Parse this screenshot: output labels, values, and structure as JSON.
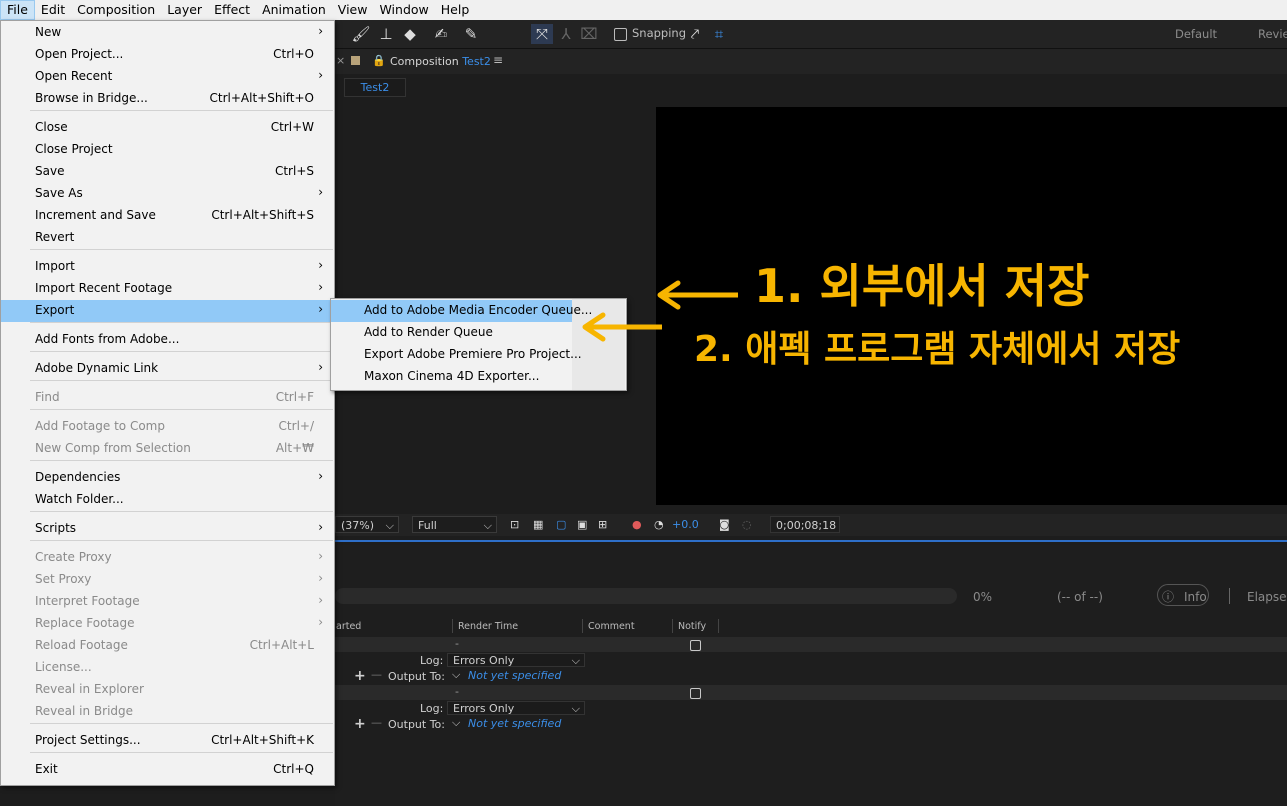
{
  "menubar": [
    "File",
    "Edit",
    "Composition",
    "Layer",
    "Effect",
    "Animation",
    "View",
    "Window",
    "Help"
  ],
  "toolbar": {
    "snapping": "Snapping",
    "workspaces": [
      "Default",
      "Review"
    ]
  },
  "composition": {
    "tab_prefix": "Composition",
    "tab_name": "Test2",
    "subtab": "Test2"
  },
  "viewer_bar": {
    "zoom": "(37%)",
    "resolution": "Full",
    "exposure": "+0.0",
    "timecode": "0;00;08;18"
  },
  "render_queue": {
    "progress": "0%",
    "count": "(-- of --)",
    "info": "Info",
    "elapsed": "Elapse",
    "headers": {
      "started": "arted",
      "render_time": "Render Time",
      "comment": "Comment",
      "notify": "Notify"
    },
    "items": [
      {
        "dash": "-",
        "log_label": "Log:",
        "log": "Errors Only",
        "output_label": "Output To:",
        "output": "Not yet specified"
      },
      {
        "dash": "-",
        "log_label": "Log:",
        "log": "Errors Only",
        "output_label": "Output To:",
        "output": "Not yet specified"
      }
    ]
  },
  "file_menu": [
    {
      "label": "New",
      "shortcut": "",
      "arrow": true,
      "disabled": false
    },
    {
      "label": "Open Project...",
      "shortcut": "Ctrl+O",
      "arrow": false,
      "disabled": false
    },
    {
      "label": "Open Recent",
      "shortcut": "",
      "arrow": true,
      "disabled": false
    },
    {
      "label": "Browse in Bridge...",
      "shortcut": "Ctrl+Alt+Shift+O",
      "arrow": false,
      "disabled": false
    },
    {
      "label": "Close",
      "shortcut": "Ctrl+W",
      "arrow": false,
      "disabled": false
    },
    {
      "label": "Close Project",
      "shortcut": "",
      "arrow": false,
      "disabled": false
    },
    {
      "label": "Save",
      "shortcut": "Ctrl+S",
      "arrow": false,
      "disabled": false
    },
    {
      "label": "Save As",
      "shortcut": "",
      "arrow": true,
      "disabled": false
    },
    {
      "label": "Increment and Save",
      "shortcut": "Ctrl+Alt+Shift+S",
      "arrow": false,
      "disabled": false
    },
    {
      "label": "Revert",
      "shortcut": "",
      "arrow": false,
      "disabled": false
    },
    {
      "label": "Import",
      "shortcut": "",
      "arrow": true,
      "disabled": false
    },
    {
      "label": "Import Recent Footage",
      "shortcut": "",
      "arrow": true,
      "disabled": false
    },
    {
      "label": "Export",
      "shortcut": "",
      "arrow": true,
      "disabled": false,
      "highlighted": true
    },
    {
      "label": "Add Fonts from Adobe...",
      "shortcut": "",
      "arrow": false,
      "disabled": false
    },
    {
      "label": "Adobe Dynamic Link",
      "shortcut": "",
      "arrow": true,
      "disabled": false
    },
    {
      "label": "Find",
      "shortcut": "Ctrl+F",
      "arrow": false,
      "disabled": true
    },
    {
      "label": "Add Footage to Comp",
      "shortcut": "Ctrl+/",
      "arrow": false,
      "disabled": true
    },
    {
      "label": "New Comp from Selection",
      "shortcut": "Alt+₩",
      "arrow": false,
      "disabled": true
    },
    {
      "label": "Dependencies",
      "shortcut": "",
      "arrow": true,
      "disabled": false
    },
    {
      "label": "Watch Folder...",
      "shortcut": "",
      "arrow": false,
      "disabled": false
    },
    {
      "label": "Scripts",
      "shortcut": "",
      "arrow": true,
      "disabled": false
    },
    {
      "label": "Create Proxy",
      "shortcut": "",
      "arrow": true,
      "disabled": true
    },
    {
      "label": "Set Proxy",
      "shortcut": "",
      "arrow": true,
      "disabled": true
    },
    {
      "label": "Interpret Footage",
      "shortcut": "",
      "arrow": true,
      "disabled": true
    },
    {
      "label": "Replace Footage",
      "shortcut": "",
      "arrow": true,
      "disabled": true
    },
    {
      "label": "Reload Footage",
      "shortcut": "Ctrl+Alt+L",
      "arrow": false,
      "disabled": true
    },
    {
      "label": "License...",
      "shortcut": "",
      "arrow": false,
      "disabled": true
    },
    {
      "label": "Reveal in Explorer",
      "shortcut": "",
      "arrow": false,
      "disabled": true
    },
    {
      "label": "Reveal in Bridge",
      "shortcut": "",
      "arrow": false,
      "disabled": true
    },
    {
      "label": "Project Settings...",
      "shortcut": "Ctrl+Alt+Shift+K",
      "arrow": false,
      "disabled": false
    },
    {
      "label": "Exit",
      "shortcut": "Ctrl+Q",
      "arrow": false,
      "disabled": false
    }
  ],
  "export_submenu": [
    {
      "label": "Add to Adobe Media Encoder Queue...",
      "highlighted": true
    },
    {
      "label": "Add to Render Queue"
    },
    {
      "label": "Export Adobe Premiere Pro Project..."
    },
    {
      "label": "Maxon Cinema 4D Exporter..."
    }
  ],
  "annotations": {
    "first": "1. 외부에서 저장",
    "second": "2. 애펙 프로그램 자체에서 저장",
    "color": "#f7b500"
  }
}
